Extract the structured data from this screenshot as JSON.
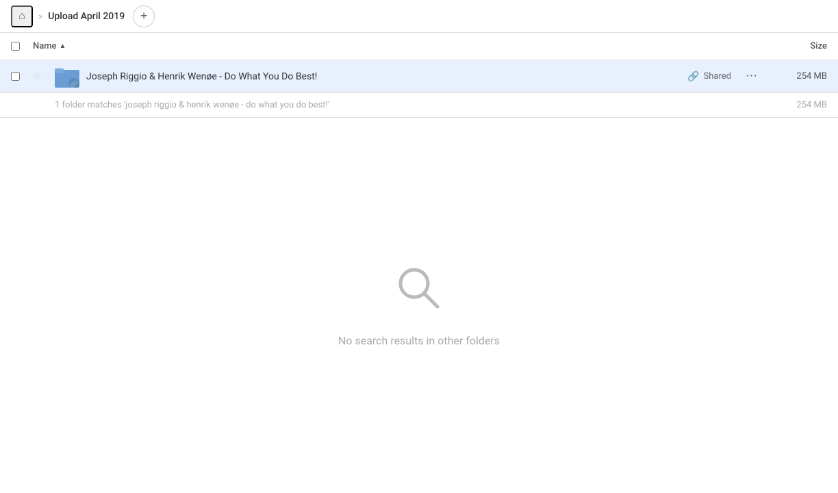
{
  "topbar": {
    "home_icon": "🏠",
    "separator": ">",
    "breadcrumb_label": "Upload April 2019",
    "add_icon": "+"
  },
  "columns": {
    "name_label": "Name",
    "sort_arrow": "▲",
    "size_label": "Size"
  },
  "file_row": {
    "star_icon": "☆",
    "name": "Joseph Riggio & Henrik Wenøe - Do What You Do Best!",
    "shared_label": "Shared",
    "more_icon": "•••",
    "size": "254 MB"
  },
  "match_info": {
    "text": "1 folder matches 'joseph riggio & henrik wenøe - do what you do best!'",
    "size": "254 MB"
  },
  "empty_state": {
    "icon": "🔍",
    "text": "No search results in other folders"
  }
}
